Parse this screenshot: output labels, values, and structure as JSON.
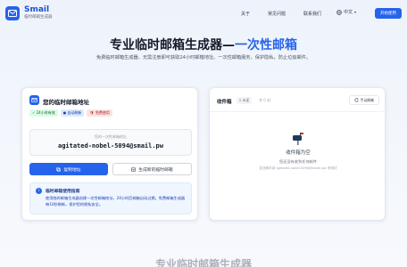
{
  "header": {
    "brand_name": "Smail",
    "brand_sub": "临时邮箱生成器",
    "nav": [
      "关于",
      "常见问题",
      "联系我们"
    ],
    "lang": "中文",
    "start_label": "开始使用"
  },
  "hero": {
    "title_main": "专业临时邮箱生成器",
    "title_dash": "—",
    "title_accent": "一次性邮箱",
    "subtitle": "免费临时邮箱生成器，无需注册即可获取24小时邮箱地址。一次性邮箱服务，保护隐私，防止垃圾邮件。"
  },
  "mailbox": {
    "title": "您的临时邮箱地址",
    "badges": [
      "✓ 24小时有效",
      "● 自动刷新",
      "🛡 免费使用"
    ],
    "email_label": "您的一次性邮箱地址",
    "email": "agitated-nobel-5094@smail.pw",
    "copy_label": "复制地址",
    "generate_label": "生成新的临时邮箱",
    "guide_title": "临时邮箱使用指南",
    "guide_text": "使用临时邮箱生成器创建一次性邮箱地址，24小时后邮箱自动过期。免费邮箱生成器每10秒刷新，保护您的隐私安全。"
  },
  "inbox": {
    "title": "收件箱",
    "unread": "0 未读",
    "count": "共 0 封",
    "refresh_label": "手动刷新",
    "empty_title": "收件箱为空",
    "empty_sub": "您还没有收到任何邮件",
    "empty_hint": "发送邮件到 agitated-nobel-5094@smail.pw 来测试"
  },
  "footer": {
    "faded_heading": "专业临时邮箱生成器"
  },
  "colors": {
    "accent": "#2563eb",
    "background": "#eef3fb"
  }
}
